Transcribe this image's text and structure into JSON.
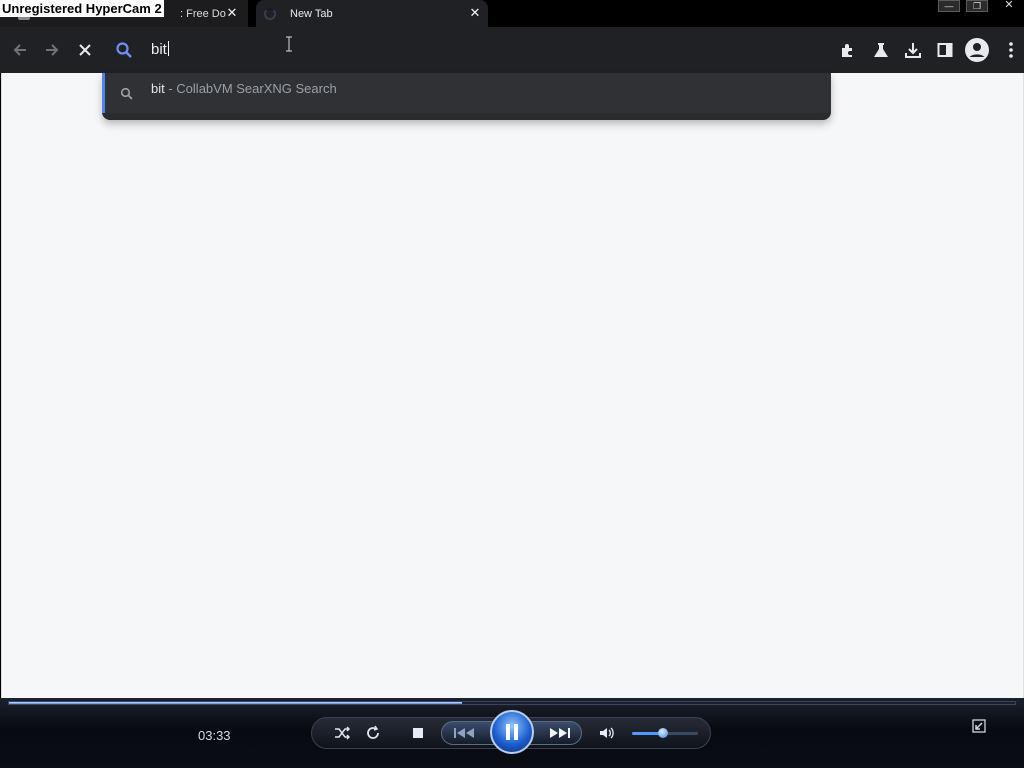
{
  "watermark": "Unregistered HyperCam 2",
  "tabs": [
    {
      "title": ": Free Do",
      "close": "✕"
    },
    {
      "title": "New Tab",
      "close": "✕"
    }
  ],
  "window_controls": {
    "minimize": "—",
    "restore": "❐",
    "close": "✕"
  },
  "omnibox": {
    "value": "bit"
  },
  "suggestion": {
    "query": "bit",
    "separator": " - ",
    "description": "CollabVM SearXNG Search"
  },
  "player": {
    "elapsed": "03:33",
    "progress_fraction": 0.45,
    "volume_fraction": 0.47
  },
  "icons": [
    "back-icon",
    "forward-icon",
    "stop-loading-icon",
    "search-icon",
    "extensions-icon",
    "labs-icon",
    "download-icon",
    "side-panel-icon",
    "profile-icon",
    "menu-icon",
    "shuffle-icon",
    "repeat-icon",
    "stop-icon",
    "previous-icon",
    "pause-icon",
    "next-icon",
    "volume-icon",
    "mini-player-icon"
  ],
  "colors": {
    "accent": "#4f86e8",
    "toolbar": "#202124",
    "page_bg": "#f6f7f8"
  }
}
